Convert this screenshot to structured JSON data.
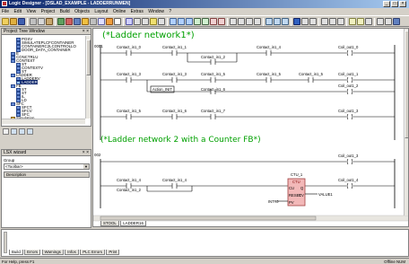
{
  "window": {
    "title": "Logic Designer - [DSLAD_EXAMPLE - LADDERRUNMEN]"
  },
  "menu": [
    "File",
    "Edit",
    "View",
    "Project",
    "Build",
    "Objects",
    "Layout",
    "Online",
    "Extras",
    "Window",
    "?"
  ],
  "project_tree": {
    "title": "Project Tree Window",
    "items": [
      {
        "label": "POSV",
        "indent": 2,
        "kind": "file"
      },
      {
        "label": "SIMULATEPLCFCONTAINER",
        "indent": 2,
        "kind": "file"
      },
      {
        "label": "CONTAINERC2LCONTROLLO",
        "indent": 2,
        "kind": "file"
      },
      {
        "label": "DOOR_DATA_CONTAINER",
        "indent": 2,
        "kind": "file"
      },
      {
        "label": "E",
        "indent": 1,
        "kind": "folder"
      },
      {
        "label": "CONCTRLU",
        "indent": 1,
        "kind": "folder"
      },
      {
        "label": "CONTEXT",
        "indent": 1,
        "kind": "folder"
      },
      {
        "label": "ST",
        "indent": 2,
        "kind": "file"
      },
      {
        "label": "CONTEXTV",
        "indent": 2,
        "kind": "file"
      },
      {
        "label": "ST",
        "indent": 2,
        "kind": "file"
      },
      {
        "label": "LADDER",
        "indent": 1,
        "kind": "folder"
      },
      {
        "label": "LADDERV",
        "indent": 2,
        "kind": "file"
      },
      {
        "label": "LADDER",
        "indent": 2,
        "kind": "file",
        "selected": true
      },
      {
        "label": "FB",
        "indent": 1,
        "kind": "folder"
      },
      {
        "label": "ST",
        "indent": 2,
        "kind": "file"
      },
      {
        "label": "ST",
        "indent": 2,
        "kind": "file"
      },
      {
        "label": "IL",
        "indent": 2,
        "kind": "file"
      },
      {
        "label": "LD",
        "indent": 2,
        "kind": "file"
      },
      {
        "label": "SFC",
        "indent": 1,
        "kind": "folder"
      },
      {
        "label": "SFCT",
        "indent": 2,
        "kind": "file"
      },
      {
        "label": "SFCV",
        "indent": 2,
        "kind": "file"
      },
      {
        "label": "SFC",
        "indent": 2,
        "kind": "file"
      },
      {
        "label": "Simulation",
        "indent": 1,
        "kind": "plc"
      }
    ]
  },
  "lsx_wizard": {
    "title": "LSX wizard",
    "group_label": "Group",
    "group_value": "<Toolbar>",
    "description_header": "Description"
  },
  "ladder": {
    "net1": {
      "comment": "(*Ladder network1*)",
      "step": "0001",
      "row1": {
        "c1": "Contact_in1_0",
        "c2": "Contact_in1_1",
        "c3": "Contact_in1_4",
        "coil": "Coil_out1_0"
      },
      "branch1": {
        "c1": "Contact_in1_2"
      },
      "row2": {
        "c1": "Contact_in1_3",
        "c2": "Contact_in1_3",
        "c3": "Contact_in1_5",
        "c4": "Contact_in1_5",
        "coil": "Coil_out1_1"
      },
      "branch2": {
        "action": "Action_INIT",
        "c1": "Contact_in1_6",
        "coil": "Coil_out1_2"
      },
      "row3": {
        "c1": "Contact_in1_5",
        "c2": "Contact_in1_6",
        "c3": "Contact_in1_7",
        "coil": "Coil_out1_3"
      }
    },
    "net2": {
      "comment": "(*Ladder network 2 with a Counter FB*)",
      "step": "002",
      "row1": {
        "coil": "Coil_out1_3"
      },
      "fb": {
        "instance": "CTU_1",
        "type": "CTU",
        "pins_in": [
          "CU",
          "RESET",
          "PV"
        ],
        "pins_out": [
          "Q",
          "CV"
        ],
        "out_var": "VALUE1",
        "pv_var": "INT#0"
      },
      "row2": {
        "c1": "Contact_in1_4",
        "c2": "Contact_in1_4",
        "coil": "Coil_out1_4"
      },
      "branch": {
        "c1": "Contact_in1_2"
      }
    }
  },
  "editor_tabs": [
    "STOOL",
    "LADDER16"
  ],
  "messages": {
    "tabs": [
      "Build",
      "Errors",
      "Warnings",
      "Infos",
      "PLC Errors",
      "Print"
    ]
  },
  "status": {
    "left": "For Help, press F1",
    "right": "Offline    NUM"
  }
}
